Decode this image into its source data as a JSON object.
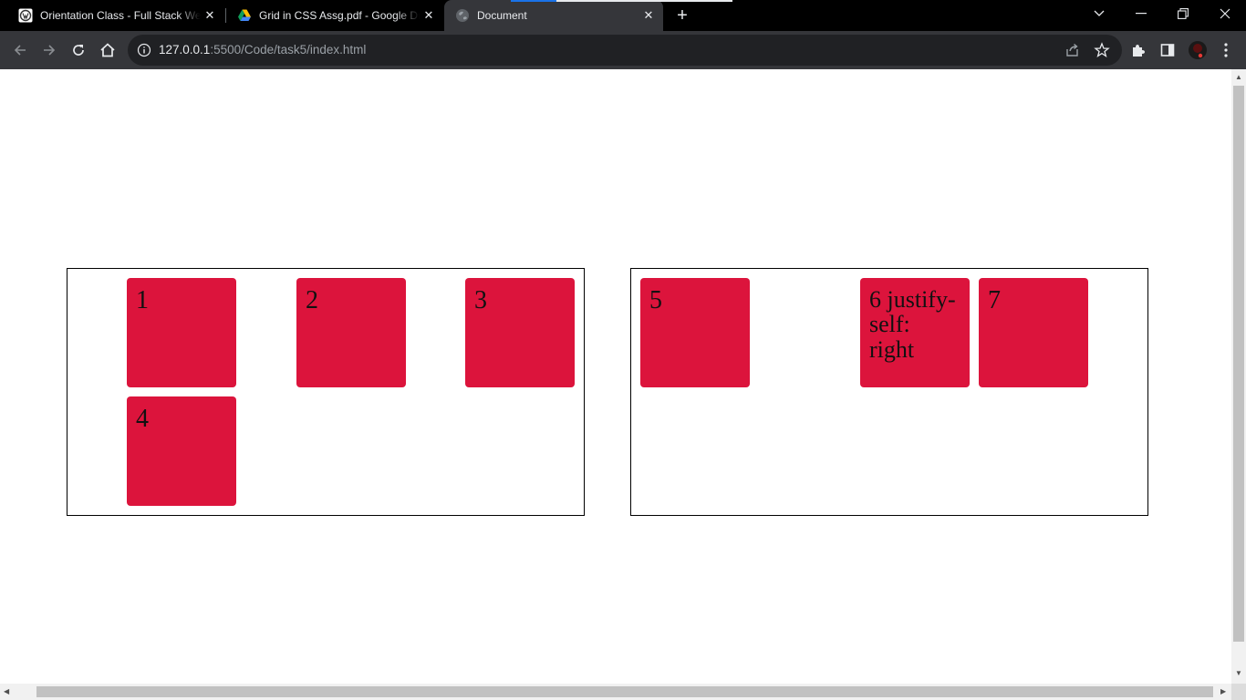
{
  "browser": {
    "tabs": [
      {
        "title": "Orientation Class - Full Stack We",
        "icon": "wordpress-icon",
        "active": false
      },
      {
        "title": "Grid in CSS Assg.pdf - Google Dri",
        "icon": "google-drive-icon",
        "active": false
      },
      {
        "title": "Document",
        "icon": "globe-icon",
        "active": true
      }
    ],
    "close_glyph": "✕",
    "new_tab_glyph": "+",
    "address": {
      "host": "127.0.0.1",
      "path": ":5500/Code/task5/index.html"
    }
  },
  "page": {
    "grid_left": {
      "items": [
        "1",
        "2",
        "3",
        "4"
      ]
    },
    "grid_right": {
      "items": [
        "5",
        "6 justify-self: right",
        "7"
      ]
    }
  },
  "colors": {
    "item_background": "#dc143c",
    "tab_strip": "#000000",
    "toolbar": "#35363a",
    "omnibox": "#202124"
  }
}
